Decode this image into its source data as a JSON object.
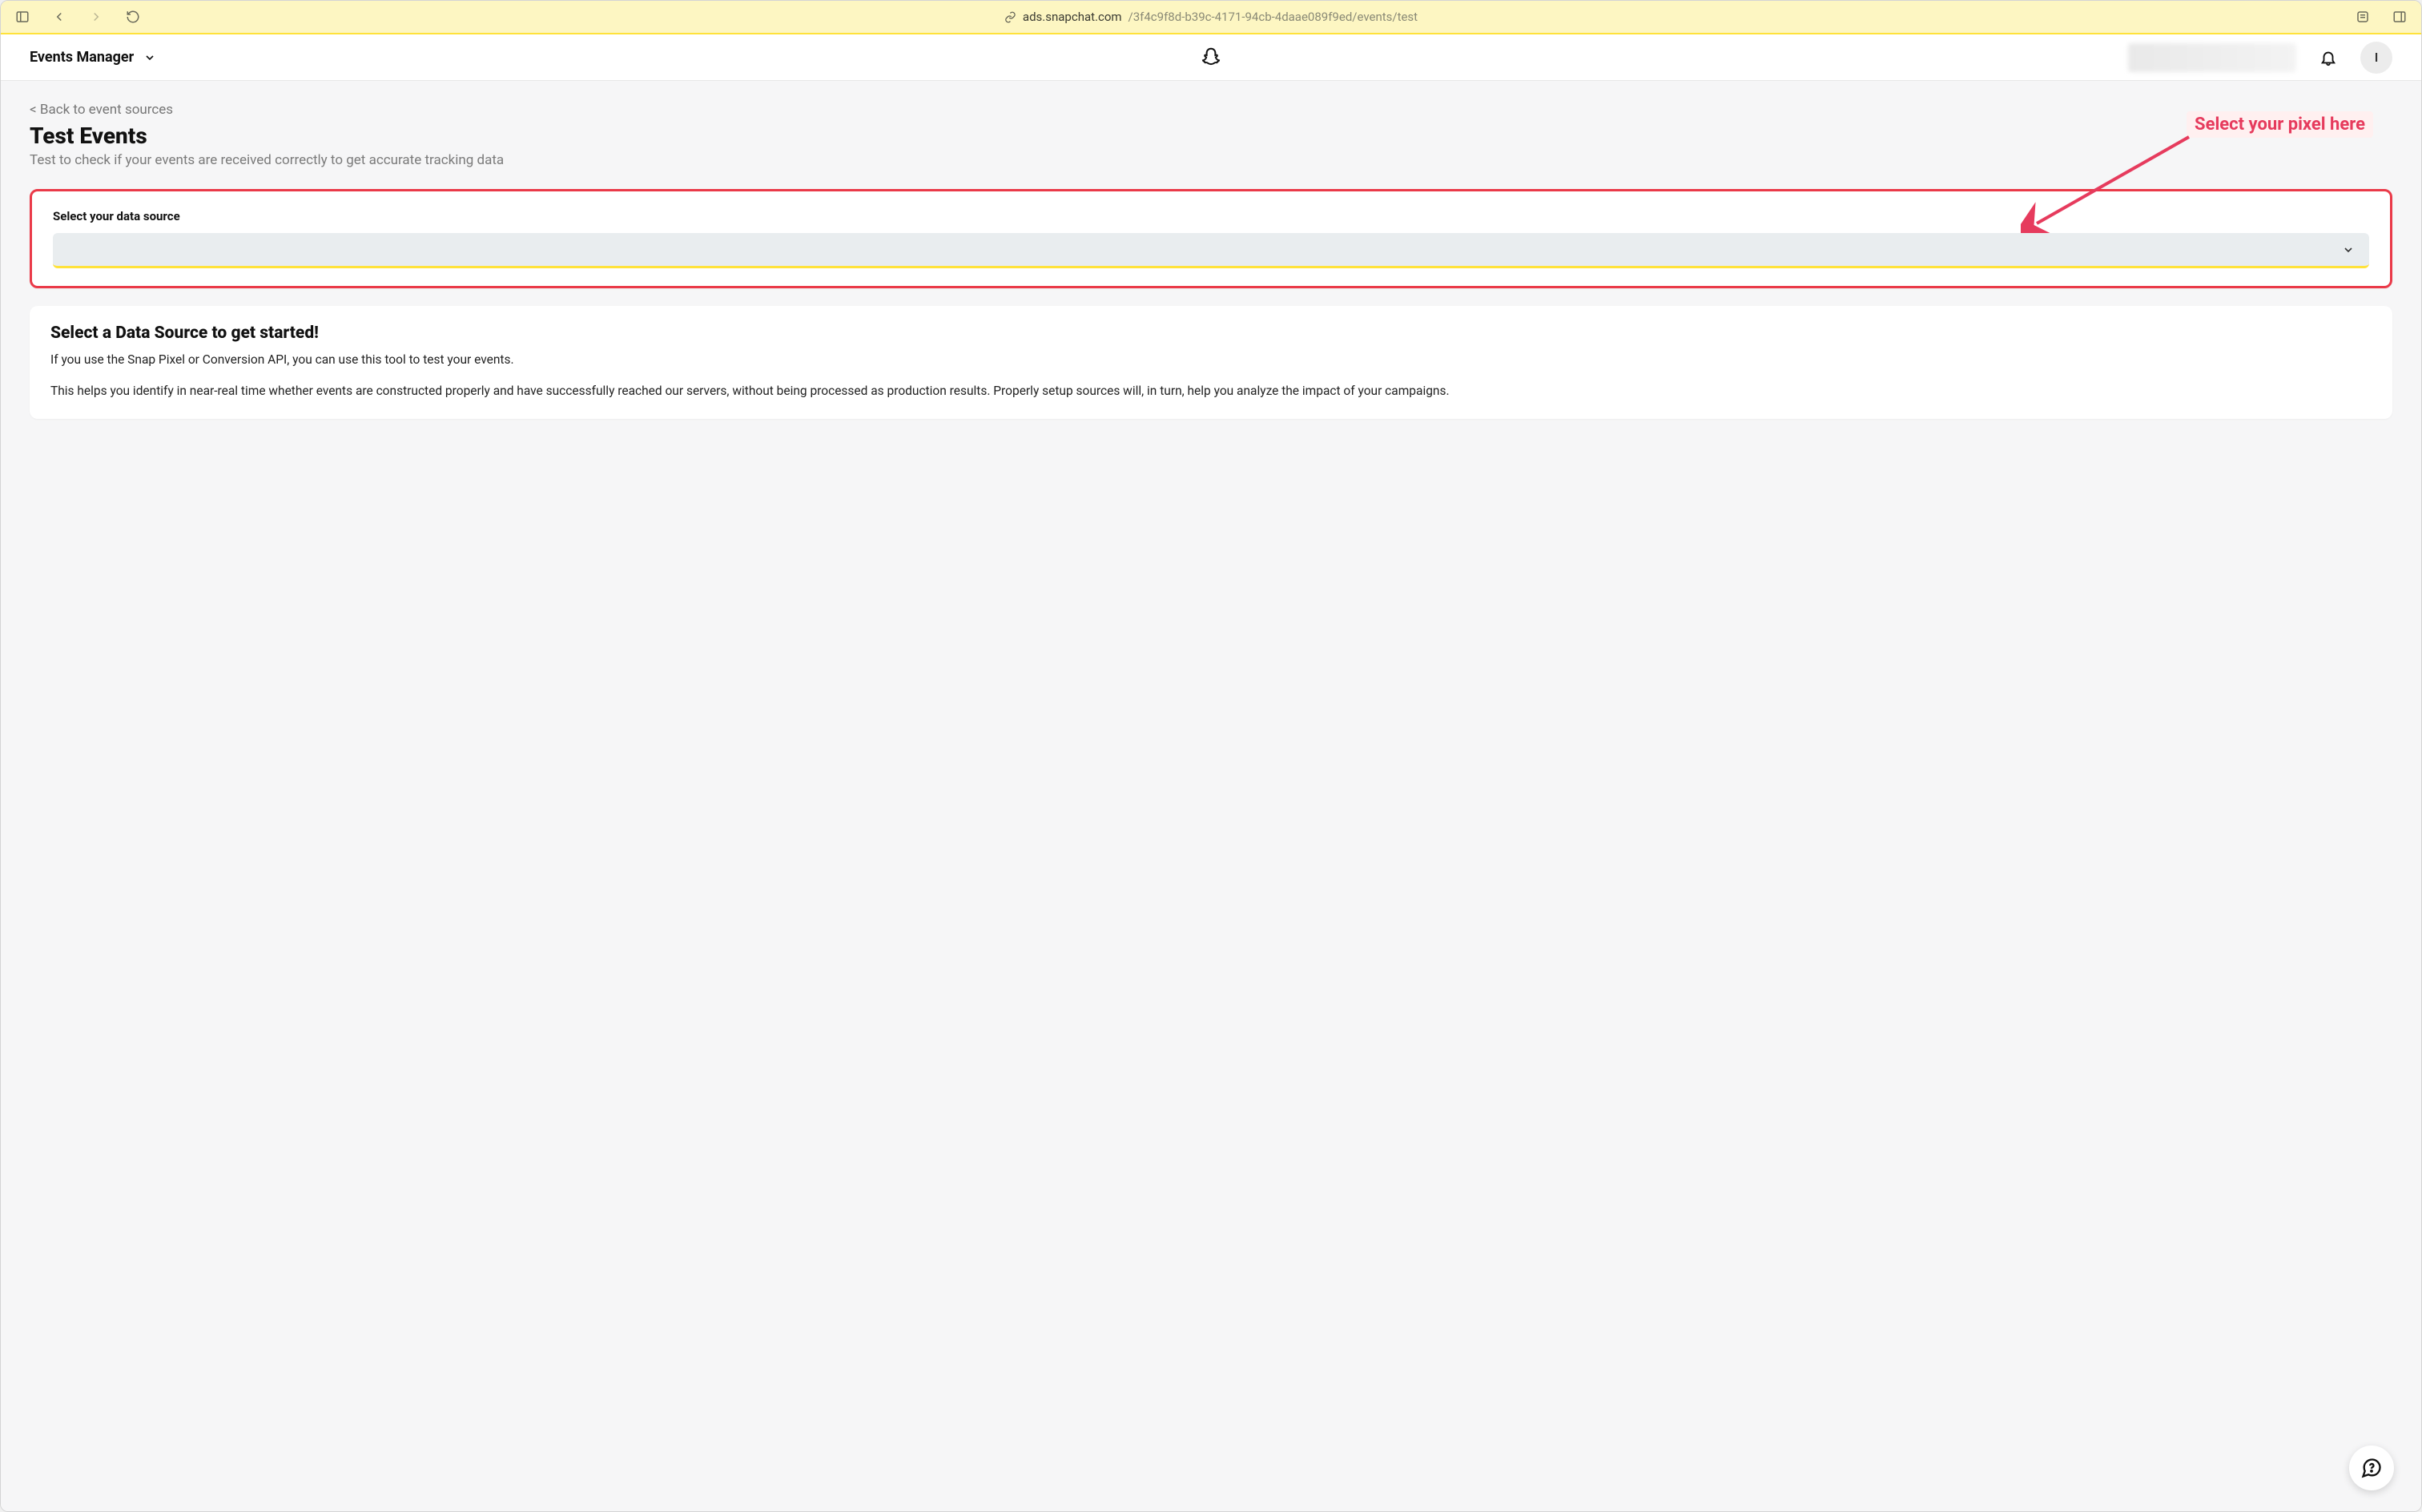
{
  "browser": {
    "url_domain": "ads.snapchat.com",
    "url_path": "/3f4c9f8d-b39c-4171-94cb-4daae089f9ed/events/test"
  },
  "header": {
    "app_title": "Events Manager",
    "avatar_initial": "I"
  },
  "callout": "Select your pixel here",
  "page": {
    "back_link": "< Back to event sources",
    "title": "Test Events",
    "subtitle": "Test to check if your events are received correctly to get accurate tracking data"
  },
  "data_source_card": {
    "label": "Select your data source",
    "selected_value": ""
  },
  "info_card": {
    "title": "Select a Data Source to get started!",
    "p1": "If you use the Snap Pixel or Conversion API, you can use this tool to test your events.",
    "p2": "This helps you identify in near-real time whether events are constructed properly and have successfully reached our servers, without being processed as production results. Properly setup sources will, in turn, help you analyze the impact of your campaigns."
  }
}
